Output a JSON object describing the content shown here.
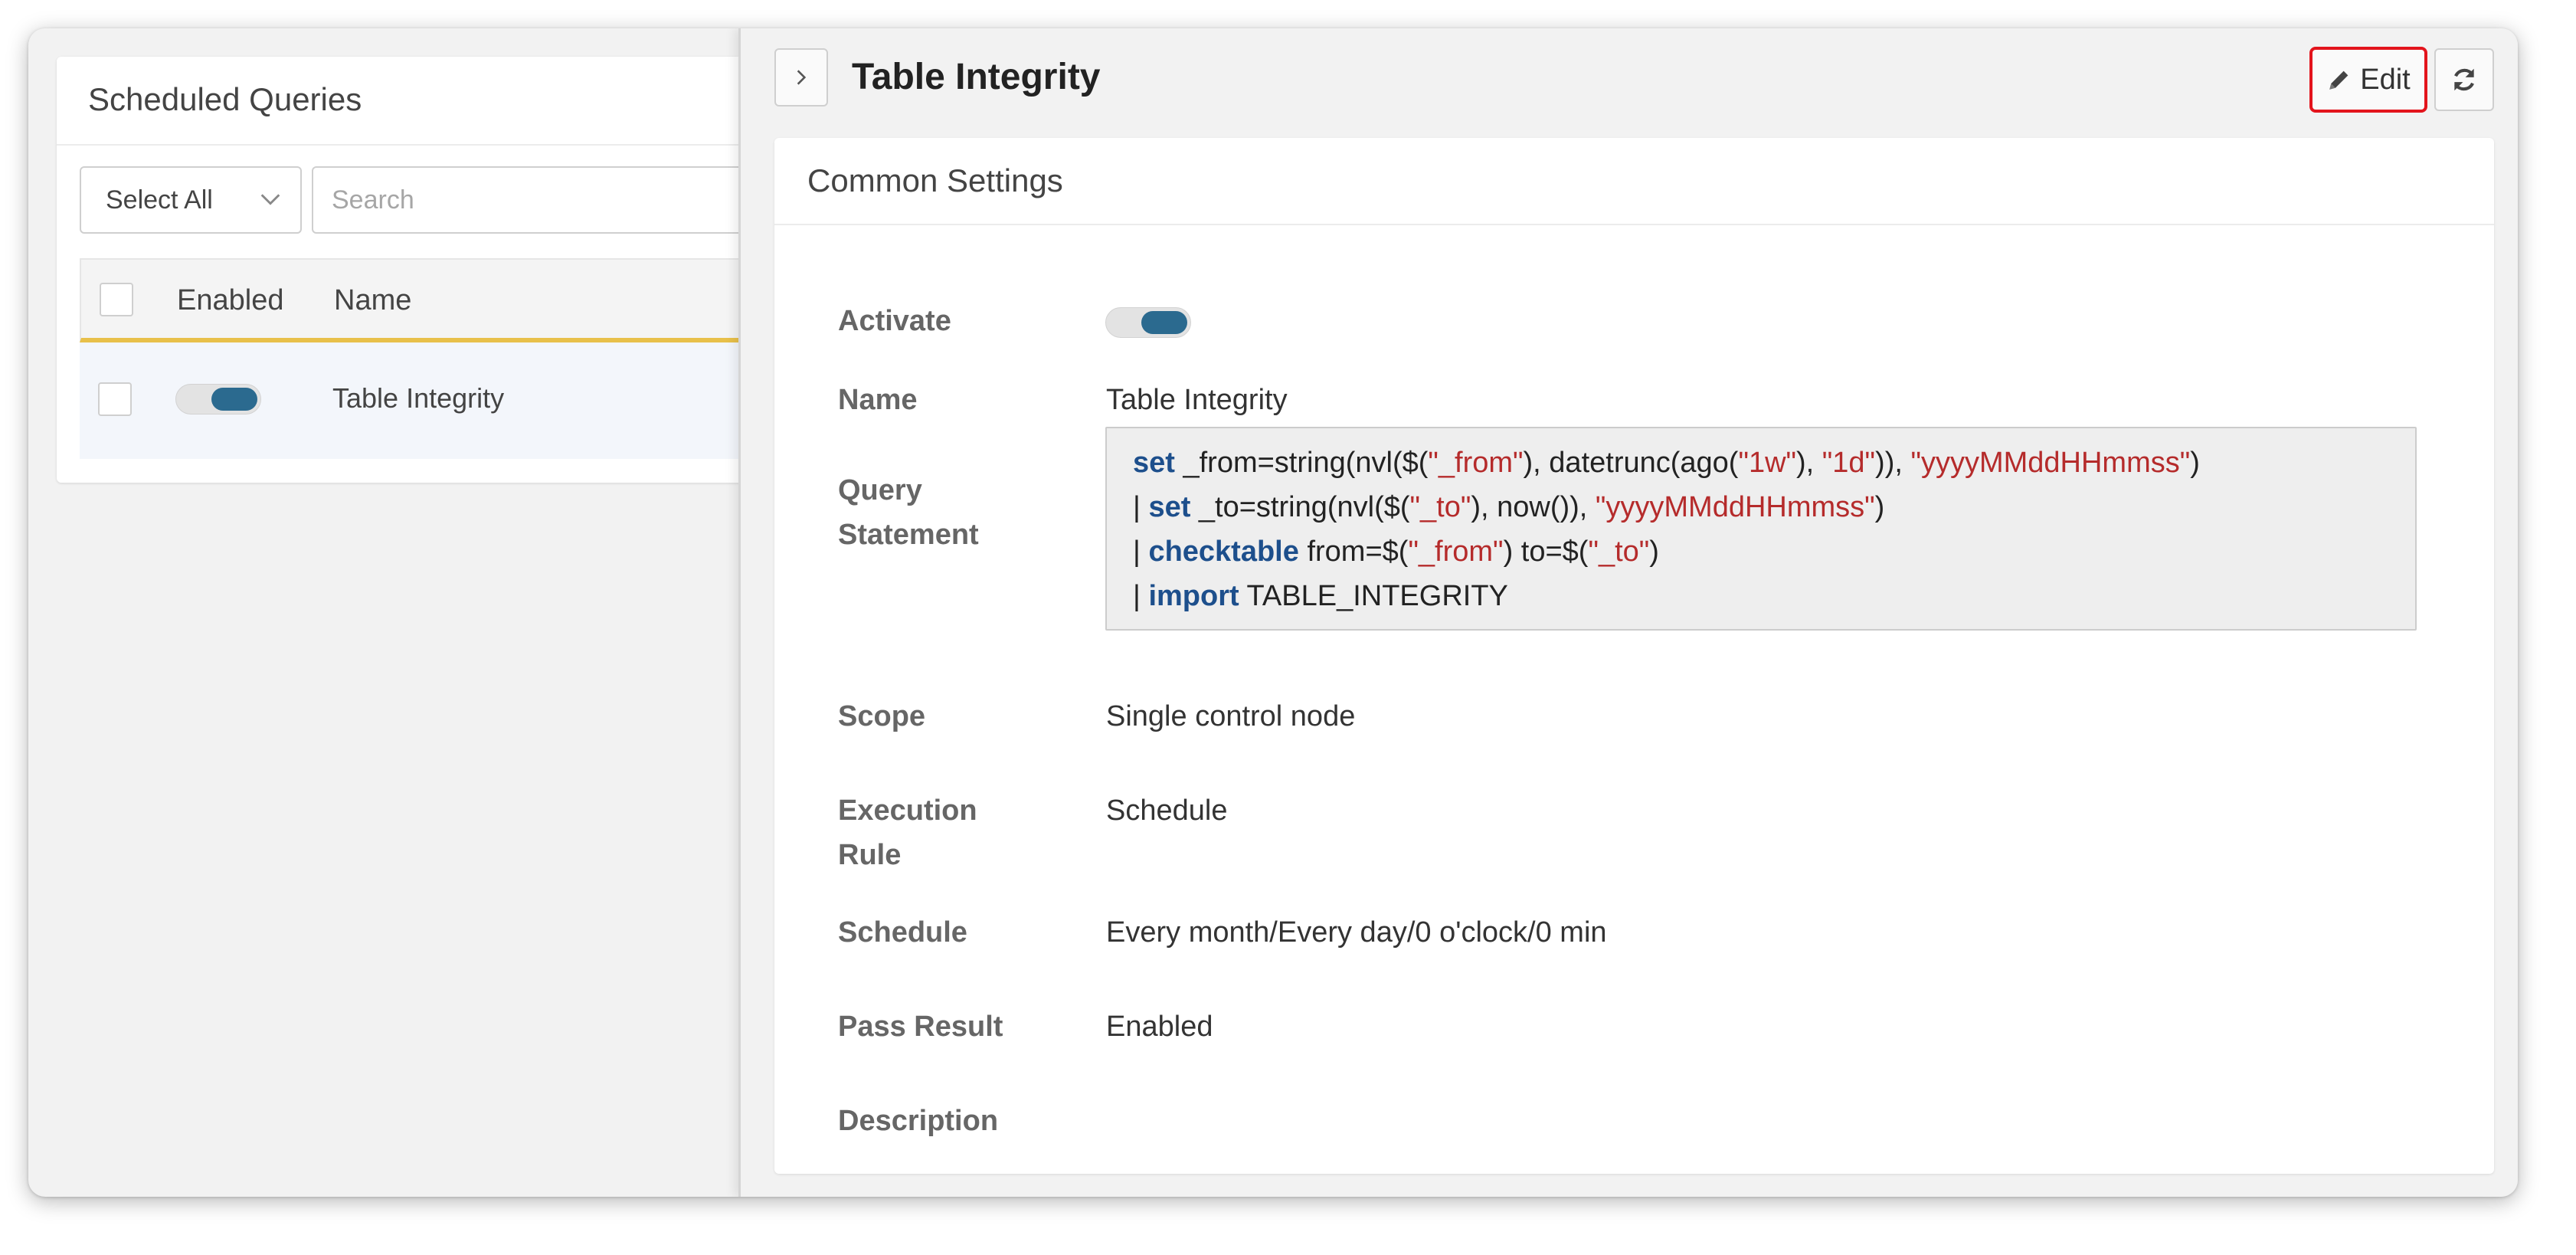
{
  "list": {
    "title": "Scheduled Queries",
    "select_all": "Select All",
    "search_placeholder": "Search",
    "columns": {
      "enabled": "Enabled",
      "name": "Name"
    },
    "rows": [
      {
        "name": "Table Integrity",
        "enabled": true
      }
    ]
  },
  "detail": {
    "title": "Table Integrity",
    "edit_label": "Edit",
    "card_title": "Common Settings",
    "fields": {
      "activate_label": "Activate",
      "activate_on": true,
      "name_label": "Name",
      "name_value": "Table Integrity",
      "query_label_line1": "Query",
      "query_label_line2": "Statement",
      "query_lines": [
        {
          "prefix": "",
          "kw": "set",
          "parts": [
            {
              "t": " _from=string(nvl($(",
              "s": false
            },
            {
              "t": "\"_from\"",
              "s": true
            },
            {
              "t": "), datetrunc(ago(",
              "s": false
            },
            {
              "t": "\"1w\"",
              "s": true
            },
            {
              "t": "), ",
              "s": false
            },
            {
              "t": "\"1d\"",
              "s": true
            },
            {
              "t": ")), ",
              "s": false
            },
            {
              "t": "\"yyyyMMddHHmmss\"",
              "s": true
            },
            {
              "t": ")",
              "s": false
            }
          ]
        },
        {
          "prefix": "| ",
          "kw": "set",
          "parts": [
            {
              "t": " _to=string(nvl($(",
              "s": false
            },
            {
              "t": "\"_to\"",
              "s": true
            },
            {
              "t": "), now()), ",
              "s": false
            },
            {
              "t": "\"yyyyMMddHHmmss\"",
              "s": true
            },
            {
              "t": ")",
              "s": false
            }
          ]
        },
        {
          "prefix": "| ",
          "kw": "checktable",
          "parts": [
            {
              "t": " from=$(",
              "s": false
            },
            {
              "t": "\"_from\"",
              "s": true
            },
            {
              "t": ") to=$(",
              "s": false
            },
            {
              "t": "\"_to\"",
              "s": true
            },
            {
              "t": ")",
              "s": false
            }
          ]
        },
        {
          "prefix": "| ",
          "kw": "import",
          "parts": [
            {
              "t": " TABLE_INTEGRITY",
              "s": false
            }
          ]
        }
      ],
      "scope_label": "Scope",
      "scope_value": "Single control node",
      "exec_label_line1": "Execution",
      "exec_label_line2": "Rule",
      "exec_value": "Schedule",
      "schedule_label": "Schedule",
      "schedule_value": "Every month/Every day/0 o'clock/0 min",
      "pass_label": "Pass Result",
      "pass_value": "Enabled",
      "description_label": "Description"
    }
  },
  "colors": {
    "accent": "#2b6a8f",
    "highlight": "#e3141c",
    "header_underline": "#e8c04a",
    "keyword": "#1d4f8c",
    "string": "#b52b2b"
  },
  "icons": {
    "collapse": "chevron-right-icon",
    "edit": "pencil-icon",
    "refresh": "refresh-icon",
    "dropdown": "chevron-down-icon"
  }
}
